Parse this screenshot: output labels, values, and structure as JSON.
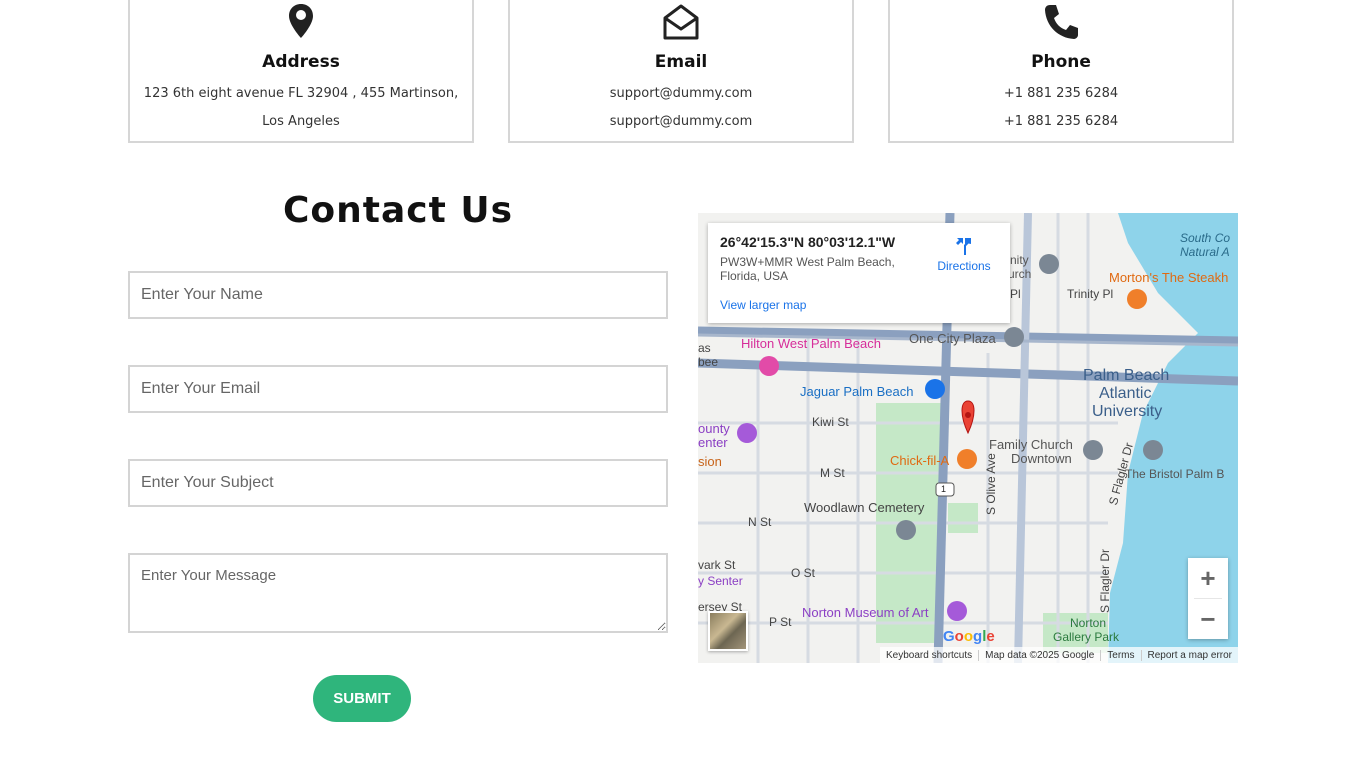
{
  "cards": [
    {
      "icon": "map-pin-icon",
      "title": "Address",
      "line1": "123 6th eight avenue FL 32904 , 455 Martinson,",
      "line2": "Los Angeles"
    },
    {
      "icon": "envelope-open-icon",
      "title": "Email",
      "line1": "support@dummy.com",
      "line2": "support@dummy.com"
    },
    {
      "icon": "phone-icon",
      "title": "Phone",
      "line1": "+1 881 235 6284",
      "line2": "+1 881 235 6284"
    }
  ],
  "contact": {
    "title": "Contact Us",
    "name_placeholder": "Enter Your Name",
    "email_placeholder": "Enter Your Email",
    "subject_placeholder": "Enter Your Subject",
    "message_placeholder": "Enter Your Message",
    "submit_label": "SUBMIT",
    "accent": "#2fb57c"
  },
  "map": {
    "coord": "26°42'15.3\"N 80°03'12.1\"W",
    "address": "PW3W+MMR West Palm Beach, Florida, USA",
    "directions": "Directions",
    "larger_map": "View larger map",
    "labels": {
      "hilton": "Hilton West Palm Beach",
      "one_city": "One City Plaza",
      "jaguar": "Jaguar Palm Beach",
      "kiwi": "Kiwi St",
      "m_st": "M St",
      "n_st": "N St",
      "o_st": "O St",
      "p_st": "P St",
      "woodlawn": "Woodlawn Cemetery",
      "chick": "Chick-fil-A",
      "family1": "Family Church",
      "family2": "Downtown",
      "pba1": "Palm Beach",
      "pba2": "Atlantic",
      "pba3": "University",
      "bristol": "The Bristol Palm B",
      "norton": "Norton Museum of Art",
      "norton_park1": "Norton",
      "norton_park2": "Gallery Park",
      "olive": "S Olive Ave",
      "flagler1": "S Flagler Dr",
      "flagler2": "S Flagler Dr",
      "mortons": "Morton's The Steakh",
      "trinity": "Trinity Pl",
      "south_co1": "South Co",
      "south_co2": "Natural A",
      "county1": "ounty",
      "county2": "enter",
      "county3": "sion",
      "nity": "nity",
      "urch": "urch",
      "pl": "Pl",
      "as": "as",
      "bee": "bee",
      "wark": "vark St",
      "senter": "y Senter",
      "jersey": "ersey St",
      "route": "1"
    },
    "footer": [
      "Keyboard shortcuts",
      "Map data ©2025 Google",
      "Terms",
      "Report a map error"
    ],
    "logo": "Google"
  }
}
